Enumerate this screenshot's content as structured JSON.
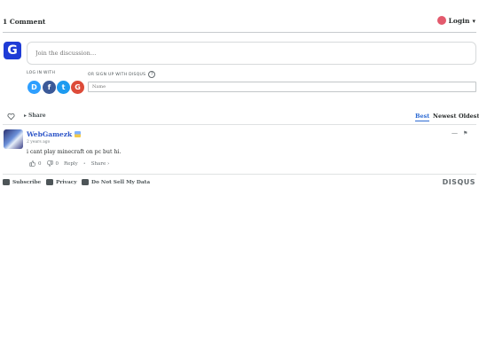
{
  "header": {
    "comment_count": "1 Comment",
    "login_label": "Login",
    "login_caret": "▾"
  },
  "composer": {
    "avatar_letter": "G",
    "placeholder": "Join the discussion…",
    "login_with": "LOG IN WITH",
    "signup_label": "OR SIGN UP WITH DISQUS",
    "help_glyph": "?",
    "name_placeholder": "Name",
    "sso": [
      {
        "letter": "D",
        "color": "#2e9fff"
      },
      {
        "letter": "f",
        "color": "#3b5998"
      },
      {
        "letter": "t",
        "color": "#1d9bf0"
      },
      {
        "letter": "G",
        "color": "#dd4b39"
      }
    ]
  },
  "toolbar": {
    "heart_glyph": "♡",
    "share_label": "Share",
    "sort": [
      "Best",
      "Newest",
      "Oldest"
    ]
  },
  "comment": {
    "author": "WebGamezk",
    "time": "2 years ago",
    "text": "i cant play minecraft on pc but hi.",
    "collapse": "—",
    "flag": "⚑",
    "upvotes": "0",
    "downvotes": "0",
    "reply_label": "Reply",
    "share_label": "Share ›"
  },
  "footer": {
    "subscribe": "Subscribe",
    "privacy": "Privacy",
    "do_not_sell": "Do Not Sell My Data",
    "brand": "DISQUS"
  }
}
